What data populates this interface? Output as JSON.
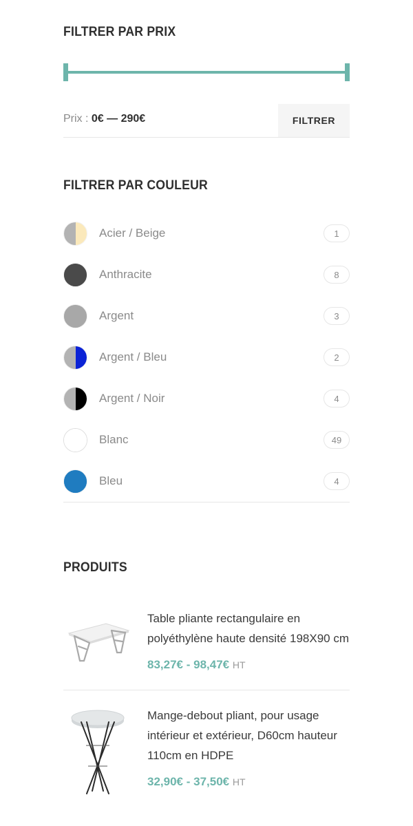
{
  "price_filter": {
    "title": "FILTRER PAR PRIX",
    "slider": {
      "min_handle": "left-handle",
      "max_handle": "right-handle",
      "track_color": "#6db5ab",
      "min_percent": 0,
      "max_percent": 100
    },
    "price_label_prefix": "Prix :",
    "price_range": "0€ — 290€",
    "min_price": "0€",
    "max_price": "290€",
    "filter_button": "FILTRER"
  },
  "color_filter": {
    "title": "FILTRER PAR COULEUR",
    "items": [
      {
        "label": "Acier / Beige",
        "count": "1",
        "left_color": "#b3b3b3",
        "right_color": "#fbe9bb",
        "style": "split"
      },
      {
        "label": "Anthracite",
        "count": "8",
        "left_color": "#4a4a4a",
        "right_color": "#4a4a4a",
        "style": "solid"
      },
      {
        "label": "Argent",
        "count": "3",
        "left_color": "#a8a8a8",
        "right_color": "#a8a8a8",
        "style": "solid"
      },
      {
        "label": "Argent / Bleu",
        "count": "2",
        "left_color": "#b3b3b3",
        "right_color": "#0b23d6",
        "style": "split"
      },
      {
        "label": "Argent / Noir",
        "count": "4",
        "left_color": "#b3b3b3",
        "right_color": "#000000",
        "style": "split"
      },
      {
        "label": "Blanc",
        "count": "49",
        "left_color": "#ffffff",
        "right_color": "#ffffff",
        "style": "outline"
      },
      {
        "label": "Bleu",
        "count": "4",
        "left_color": "#1f7cc0",
        "right_color": "#1f7cc0",
        "style": "solid"
      }
    ]
  },
  "products": {
    "title": "PRODUITS",
    "items": [
      {
        "name": "Table pliante rectangulaire en polyéthylène haute densité 198X90 cm",
        "price_min": "83,27€",
        "price_sep": " - ",
        "price_max": "98,47€",
        "tax_note": "HT",
        "image": "rectangular-folding-table"
      },
      {
        "name": "Mange-debout pliant, pour usage intérieur et extérieur, D60cm hauteur 110cm en HDPE",
        "price_min": "32,90€",
        "price_sep": " - ",
        "price_max": "37,50€",
        "tax_note": "HT",
        "image": "round-cocktail-table"
      }
    ]
  },
  "colors": {
    "accent": "#6db5ab",
    "heading": "#2f2f2f",
    "muted": "#8a8a8a",
    "divider": "#e6e6e6",
    "button_bg": "#f5f5f5"
  }
}
